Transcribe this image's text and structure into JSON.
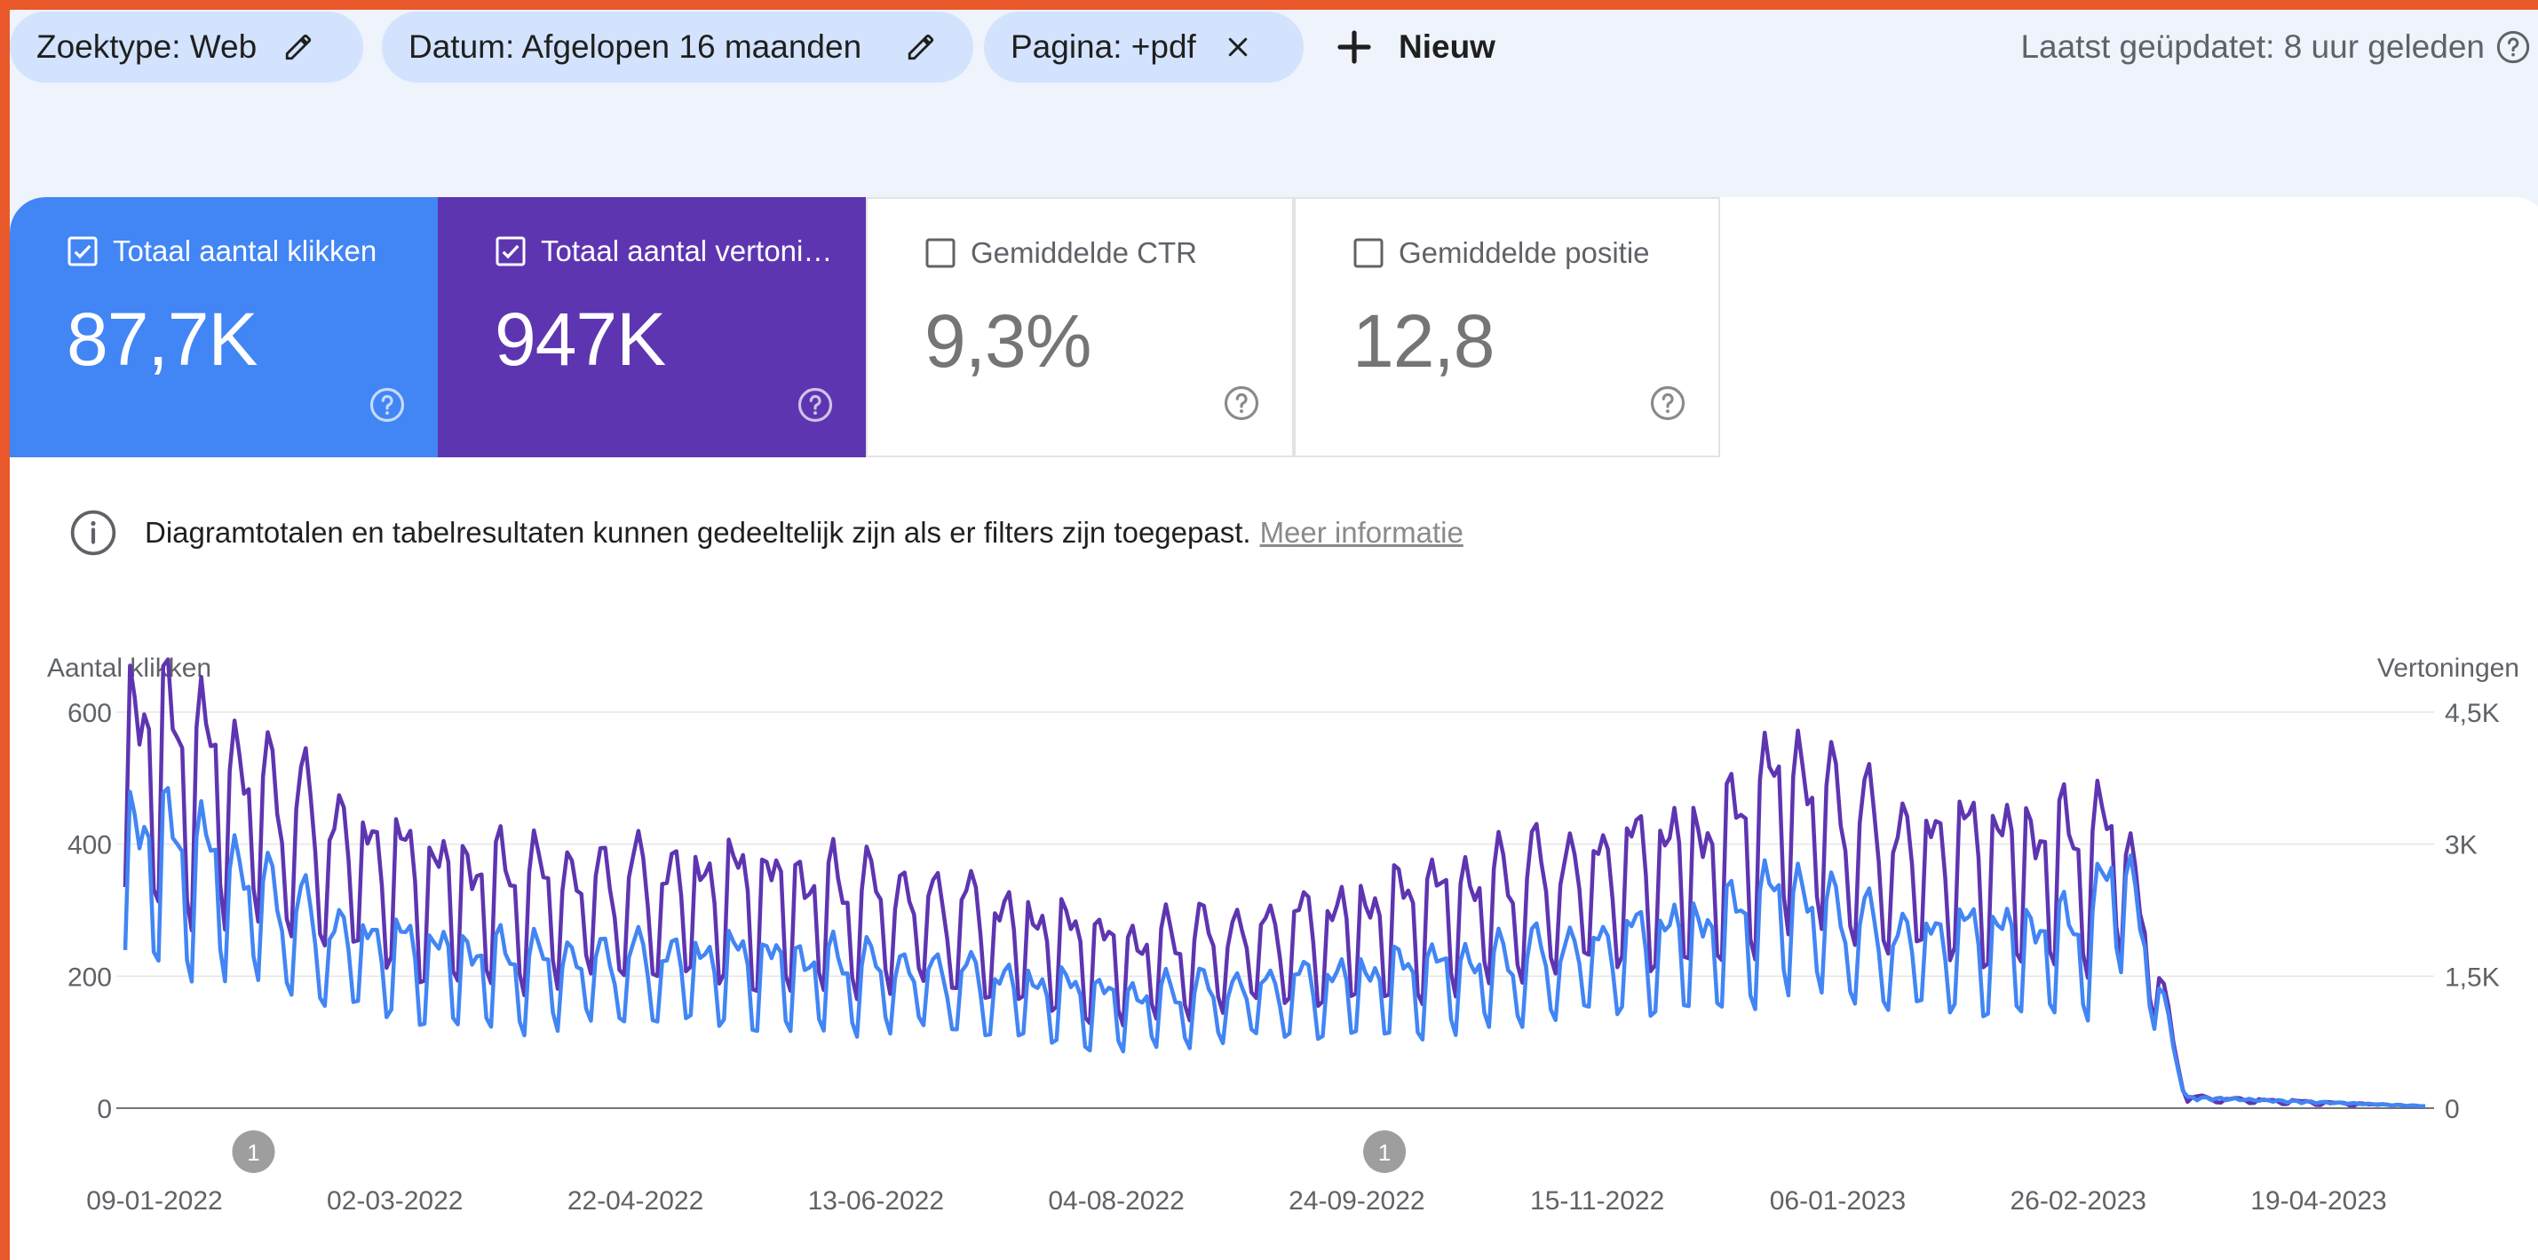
{
  "filters": {
    "type": "Zoektype: Web",
    "date": "Datum: Afgelopen 16 maanden",
    "page": "Pagina: +pdf",
    "new": "Nieuw",
    "last_updated": "Laatst geüpdatet: 8 uur geleden"
  },
  "metrics": {
    "clicks": {
      "label": "Totaal aantal klikken",
      "value": "87,7K",
      "checked": true,
      "color": "#4285f4"
    },
    "impressions": {
      "label": "Totaal aantal vertoningen",
      "value": "947K",
      "checked": true,
      "color": "#5e35b1"
    },
    "ctr": {
      "label": "Gemiddelde CTR",
      "value": "9,3%",
      "checked": false
    },
    "position": {
      "label": "Gemiddelde positie",
      "value": "12,8",
      "checked": false
    }
  },
  "notice": {
    "text": "Diagramtotalen en tabelresultaten kunnen gedeeltelijk zijn als er filters zijn toegepast.",
    "link": "Meer informatie"
  },
  "chart_data": {
    "type": "line",
    "x_labels": [
      "09-01-2022",
      "02-03-2022",
      "22-04-2022",
      "13-06-2022",
      "04-08-2022",
      "24-09-2022",
      "15-11-2022",
      "06-01-2023",
      "26-02-2023",
      "19-04-2023"
    ],
    "x_start": "2022-01-09",
    "x_end": "2023-05-08",
    "left_axis": {
      "label": "Aantal klikken",
      "ticks": [
        "0",
        "200",
        "400",
        "600"
      ],
      "range": [
        0,
        600
      ]
    },
    "right_axis": {
      "label": "Vertoningen",
      "ticks": [
        "0",
        "1,5K",
        "3K",
        "4,5K"
      ],
      "range": [
        0,
        4500
      ]
    },
    "annotations": [
      {
        "date": "2022-02-05",
        "label": "1"
      },
      {
        "date": "2022-10-01",
        "label": "1"
      }
    ],
    "series": [
      {
        "name": "Totaal aantal klikken",
        "axis": "left",
        "color": "#4285f4",
        "weekly_points": [
          {
            "date": "2022-01-09",
            "value": 410
          },
          {
            "date": "2022-01-30",
            "value": 360
          },
          {
            "date": "2022-02-20",
            "value": 260
          },
          {
            "date": "2022-03-13",
            "value": 230
          },
          {
            "date": "2022-04-03",
            "value": 215
          },
          {
            "date": "2022-05-15",
            "value": 220
          },
          {
            "date": "2022-06-26",
            "value": 200
          },
          {
            "date": "2022-08-07",
            "value": 160
          },
          {
            "date": "2022-09-18",
            "value": 185
          },
          {
            "date": "2022-10-30",
            "value": 220
          },
          {
            "date": "2022-12-11",
            "value": 270
          },
          {
            "date": "2022-12-25",
            "value": 320
          },
          {
            "date": "2023-01-15",
            "value": 250
          },
          {
            "date": "2023-02-26",
            "value": 260
          },
          {
            "date": "2023-03-05",
            "value": 380
          },
          {
            "date": "2023-03-19",
            "value": 15
          },
          {
            "date": "2023-05-08",
            "value": 3
          }
        ]
      },
      {
        "name": "Totaal aantal vertoningen",
        "axis": "right",
        "color": "#5e35b1",
        "weekly_points": [
          {
            "date": "2022-01-09",
            "value": 4300
          },
          {
            "date": "2022-01-30",
            "value": 3800
          },
          {
            "date": "2022-02-20",
            "value": 3100
          },
          {
            "date": "2022-03-13",
            "value": 2600
          },
          {
            "date": "2022-04-03",
            "value": 2500
          },
          {
            "date": "2022-05-15",
            "value": 2500
          },
          {
            "date": "2022-06-26",
            "value": 2300
          },
          {
            "date": "2022-08-07",
            "value": 1750
          },
          {
            "date": "2022-09-18",
            "value": 2050
          },
          {
            "date": "2022-10-30",
            "value": 2550
          },
          {
            "date": "2022-12-11",
            "value": 2950
          },
          {
            "date": "2022-12-25",
            "value": 3700
          },
          {
            "date": "2023-01-15",
            "value": 2950
          },
          {
            "date": "2023-02-26",
            "value": 2900
          },
          {
            "date": "2023-03-05",
            "value": 3100
          },
          {
            "date": "2023-03-19",
            "value": 120
          },
          {
            "date": "2023-05-08",
            "value": 20
          }
        ]
      }
    ]
  }
}
